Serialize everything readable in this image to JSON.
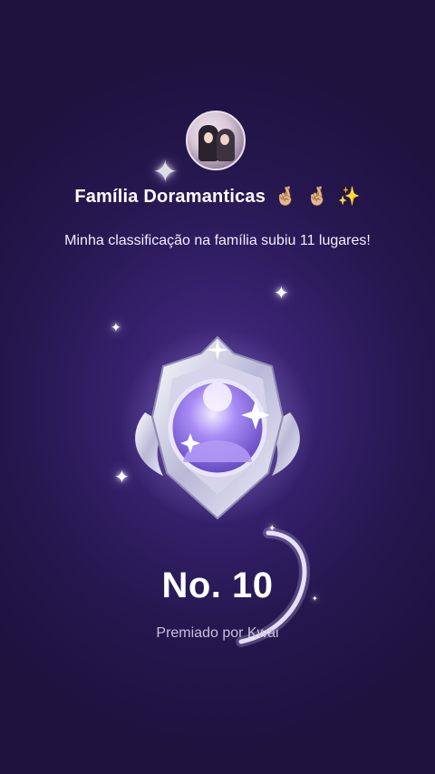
{
  "family": {
    "name": "Família Doramanticas",
    "emojis": [
      "🤞🏼",
      "🤞🏼",
      "✨"
    ]
  },
  "message": "Minha classificação na família subiu 11 lugares!",
  "rank": "No. 10",
  "awarded_by": "Premiado por Kwai",
  "colors": {
    "background": "#26174f",
    "badge_silver": "#dcdcf0",
    "badge_purple": "#8a6cf0"
  }
}
